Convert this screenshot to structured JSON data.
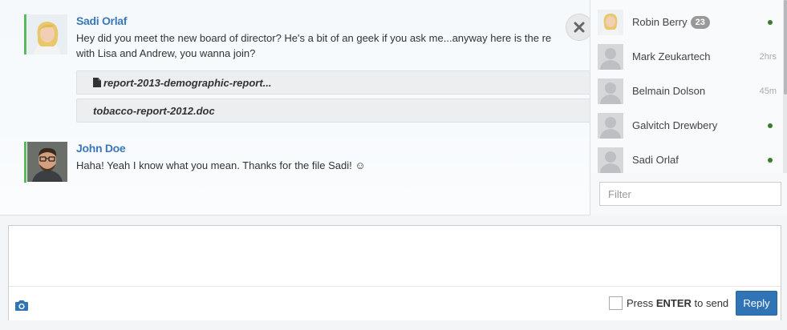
{
  "messages": [
    {
      "author": "Sadi Orlaf",
      "line1": "Hey did you meet the new board of director? He's a bit of an geek if you ask me...anyway here is the re",
      "line2": "with Lisa and Andrew, you wanna join?",
      "attachments": [
        {
          "name": "report-2013-demographic-report...",
          "icon": "file-icon"
        },
        {
          "name": "tobacco-report-2012.doc"
        }
      ]
    },
    {
      "author": "John Doe",
      "line1": "Haha! Yeah I know what you mean. Thanks for the file Sadi! ☺"
    }
  ],
  "users": [
    {
      "name": "Robin Berry",
      "badge": "23",
      "status": "online",
      "avatar": "photo"
    },
    {
      "name": "Mark Zeukartech",
      "status_text": "2hrs",
      "avatar": "placeholder"
    },
    {
      "name": "Belmain Dolson",
      "status_text": "45m",
      "avatar": "placeholder"
    },
    {
      "name": "Galvitch Drewbery",
      "status": "online",
      "avatar": "placeholder"
    },
    {
      "name": "Sadi Orlaf",
      "status": "online",
      "avatar": "placeholder"
    }
  ],
  "filter": {
    "placeholder": "Filter",
    "value": ""
  },
  "composer": {
    "value": "",
    "enter_pre": "Press ",
    "enter_key": "ENTER",
    "enter_post": " to send",
    "reply_label": "Reply"
  },
  "colors": {
    "accent": "#3174b6",
    "author": "#3a78b8",
    "online": "#3c7a2e",
    "unread_bar": "#5cb85c"
  },
  "icons": [
    "close-icon",
    "camera-icon",
    "file-icon"
  ]
}
